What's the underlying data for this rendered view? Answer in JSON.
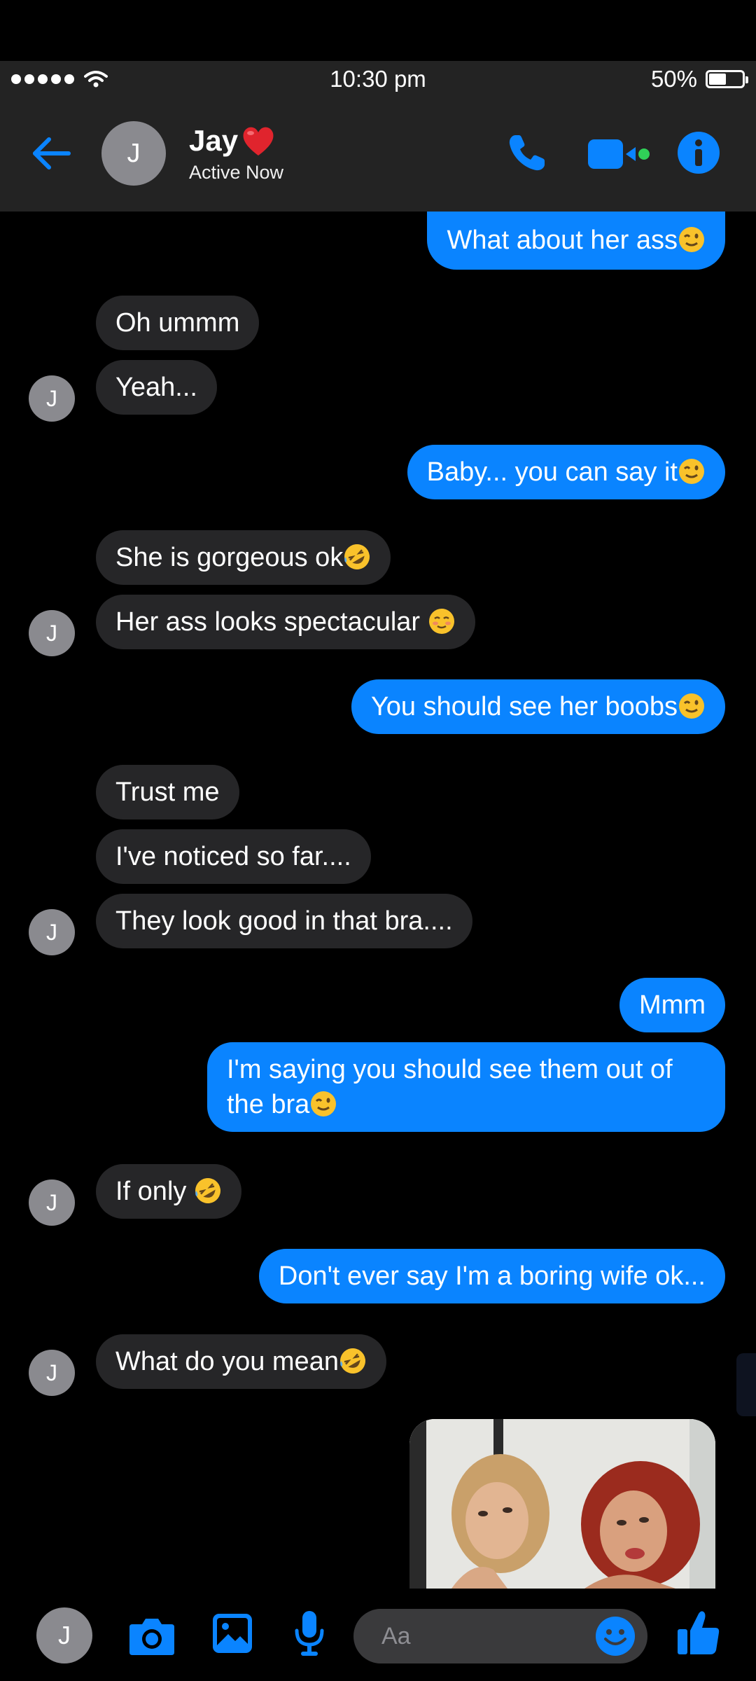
{
  "status_bar": {
    "time": "10:30 pm",
    "battery": "50%",
    "battery_level": 0.5
  },
  "header": {
    "avatar_initial": "J",
    "contact_name": "Jay",
    "contact_status": "Active Now",
    "icons": [
      "back-arrow-icon",
      "phone-icon",
      "video-call-icon",
      "info-icon"
    ],
    "accent_color": "#0a84ff"
  },
  "messages": [
    {
      "side": "out",
      "text": "What about her ass",
      "emoji": "wink"
    },
    {
      "side": "in",
      "text": "Oh ummm"
    },
    {
      "side": "in",
      "text": "Yeah...",
      "avatar": "J"
    },
    {
      "side": "out",
      "text": "Baby... you can say it",
      "emoji": "wink"
    },
    {
      "side": "in",
      "text": "She is gorgeous ok",
      "emoji": "rofl"
    },
    {
      "side": "in",
      "text": "Her ass looks spectacular ",
      "emoji": "smiling-blush",
      "avatar": "J"
    },
    {
      "side": "out",
      "text": "You should see her boobs",
      "emoji": "wink"
    },
    {
      "side": "in",
      "text": "Trust me"
    },
    {
      "side": "in",
      "text": "I've noticed so far...."
    },
    {
      "side": "in",
      "text": "They look good in that bra....",
      "avatar": "J"
    },
    {
      "side": "out",
      "text": "Mmm"
    },
    {
      "side": "out",
      "text": "I'm saying you should see them out of the bra",
      "emoji": "wink"
    },
    {
      "side": "in",
      "text": "If only ",
      "emoji": "rofl",
      "avatar": "J"
    },
    {
      "side": "out",
      "text": "Don't ever say I'm a boring wife ok..."
    },
    {
      "side": "in",
      "text": "What do you mean",
      "emoji": "rofl",
      "avatar": "J"
    },
    {
      "side": "out",
      "type": "photo"
    }
  ],
  "composer": {
    "avatar_initial": "J",
    "placeholder": "Aa",
    "icons": [
      "camera-icon",
      "photo-gallery-icon",
      "microphone-icon",
      "emoji-icon",
      "thumbs-up-icon"
    ]
  }
}
